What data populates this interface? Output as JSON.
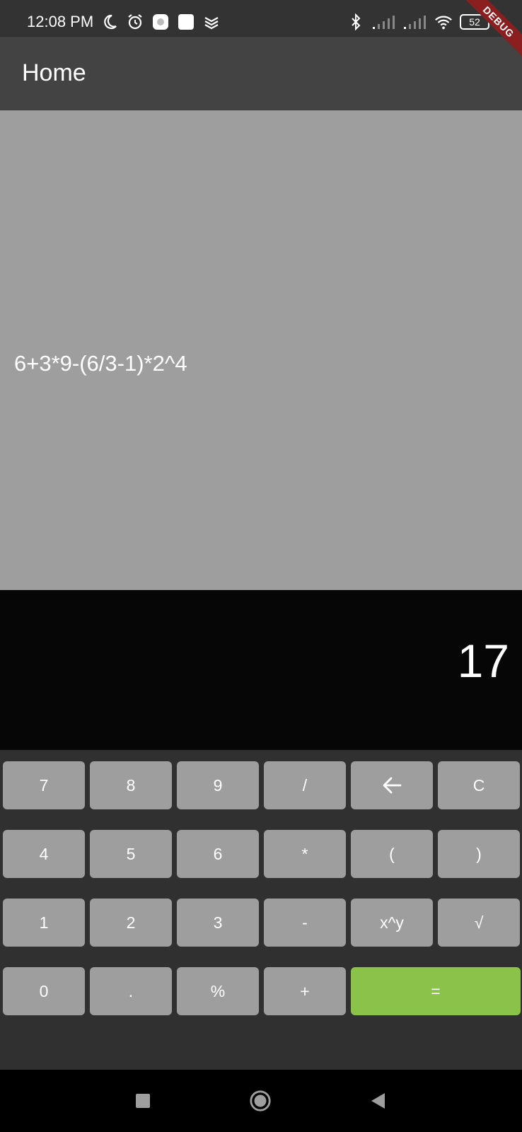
{
  "status_bar": {
    "time": "12:08 PM",
    "battery": "52",
    "icons_left": [
      "moon-icon",
      "alarm-icon",
      "app-notification-icon",
      "square-notification-icon",
      "layers-icon"
    ],
    "icons_right": [
      "bluetooth-icon",
      "signal-icon",
      "signal-icon",
      "wifi-icon",
      "battery-icon"
    ]
  },
  "debug_banner": "DEBUG",
  "app_bar": {
    "title": "Home"
  },
  "expression": "6+3*9-(6/3-1)*2^4",
  "result": "17",
  "keypad": {
    "rows": [
      [
        "7",
        "8",
        "9",
        "/",
        "←",
        "C"
      ],
      [
        "4",
        "5",
        "6",
        "*",
        "(",
        ")"
      ],
      [
        "1",
        "2",
        "3",
        "-",
        "x^y",
        "√"
      ],
      [
        "0",
        ".",
        "%",
        "+",
        "="
      ]
    ]
  },
  "colors": {
    "status_bar": "#333333",
    "app_bar": "#434343",
    "expression_bg": "#9e9e9e",
    "result_bg": "#060606",
    "keypad_bg": "#303030",
    "key_bg": "#9e9e9e",
    "equals_bg": "#8bc34a"
  },
  "nav_bar": {
    "buttons": [
      "recents-square-icon",
      "home-circle-icon",
      "back-triangle-icon"
    ]
  }
}
